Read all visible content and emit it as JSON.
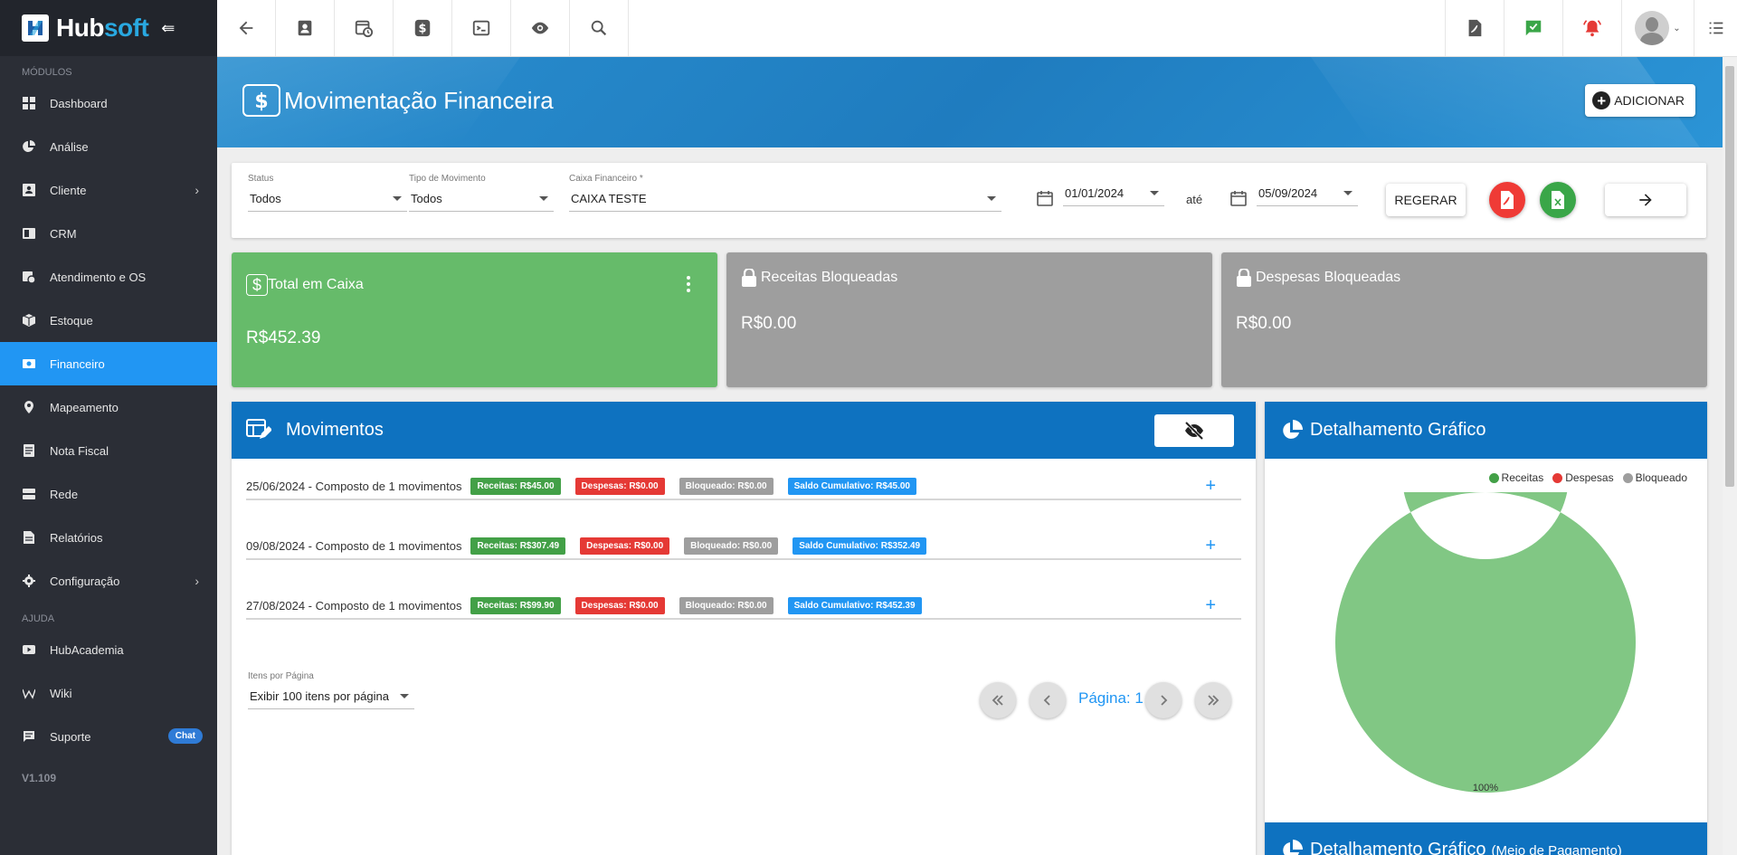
{
  "app": {
    "brand_a": "Hub",
    "brand_b": "soft",
    "version": "V1.109"
  },
  "sidebar": {
    "section_modules": "MÓDULOS",
    "section_help": "AJUDA",
    "items": [
      {
        "label": "Dashboard"
      },
      {
        "label": "Análise"
      },
      {
        "label": "Cliente"
      },
      {
        "label": "CRM"
      },
      {
        "label": "Atendimento e OS"
      },
      {
        "label": "Estoque"
      },
      {
        "label": "Financeiro"
      },
      {
        "label": "Mapeamento"
      },
      {
        "label": "Nota Fiscal"
      },
      {
        "label": "Rede"
      },
      {
        "label": "Relatórios"
      },
      {
        "label": "Configuração"
      }
    ],
    "help_items": [
      {
        "label": "HubAcademia"
      },
      {
        "label": "Wiki"
      },
      {
        "label": "Suporte",
        "badge": "Chat"
      }
    ]
  },
  "header": {
    "title": "Movimentação Financeira",
    "add_label": "ADICIONAR"
  },
  "filters": {
    "status_label": "Status",
    "status_value": "Todos",
    "tipo_label": "Tipo de Movimento",
    "tipo_value": "Todos",
    "caixa_label": "Caixa Financeiro *",
    "caixa_value": "CAIXA TESTE",
    "date_from": "01/01/2024",
    "until_label": "até",
    "date_to": "05/09/2024",
    "regerar_label": "REGERAR"
  },
  "cards": {
    "total": {
      "title": "Total em Caixa",
      "value": "R$452.39"
    },
    "receitas_bloq": {
      "title": "Receitas Bloqueadas",
      "value": "R$0.00"
    },
    "despesas_bloq": {
      "title": "Despesas Bloqueadas",
      "value": "R$0.00"
    }
  },
  "movimentos": {
    "title": "Movimentos",
    "rows": [
      {
        "desc": "25/06/2024 - Composto de 1 movimentos",
        "receitas": "Receitas: R$45.00",
        "despesas": "Despesas: R$0.00",
        "bloqueado": "Bloqueado: R$0.00",
        "saldo": "Saldo Cumulativo: R$45.00"
      },
      {
        "desc": "09/08/2024 - Composto de 1 movimentos",
        "receitas": "Receitas: R$307.49",
        "despesas": "Despesas: R$0.00",
        "bloqueado": "Bloqueado: R$0.00",
        "saldo": "Saldo Cumulativo: R$352.49"
      },
      {
        "desc": "27/08/2024 - Composto de 1 movimentos",
        "receitas": "Receitas: R$99.90",
        "despesas": "Despesas: R$0.00",
        "bloqueado": "Bloqueado: R$0.00",
        "saldo": "Saldo Cumulativo: R$452.39"
      }
    ],
    "per_page_label": "Itens por Página",
    "per_page_value": "Exibir 100 itens por página",
    "page_label": "Página: 1"
  },
  "grafico": {
    "title": "Detalhamento Gráfico",
    "title2": "Detalhamento Gráfico",
    "title2_sub": "(Meio de Pagamento)",
    "legend": [
      {
        "name": "Receitas",
        "color": "#43a047"
      },
      {
        "name": "Despesas",
        "color": "#e53935"
      },
      {
        "name": "Bloqueado",
        "color": "#9e9e9e"
      }
    ],
    "slice_label": "100%",
    "slice_color": "#81c784",
    "receitas_fraction": 1.0
  },
  "colors": {
    "sidebar": "#2b2e36",
    "active": "#2196f3",
    "header": "#1f7cbf",
    "panel_head": "#0e72c0",
    "green_card": "#66bb6a",
    "gray_card": "#9e9e9e"
  }
}
